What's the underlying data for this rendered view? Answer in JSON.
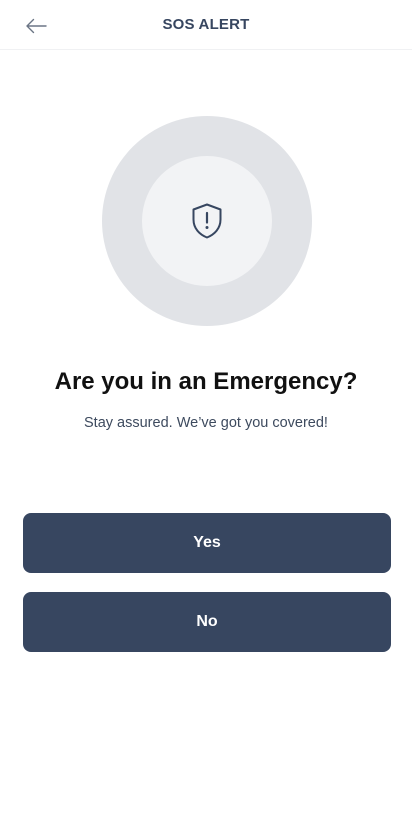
{
  "header": {
    "title": "SOS ALERT",
    "back_icon": "arrow-left-icon"
  },
  "emblem": {
    "icon": "shield-alert-icon",
    "outer_color": "#e1e3e7",
    "inner_color": "#f2f3f5",
    "icon_color": "#374660"
  },
  "main": {
    "headline": "Are you in an Emergency?",
    "subtext": "Stay assured. We’ve got you covered!"
  },
  "buttons": {
    "yes_label": "Yes",
    "no_label": "No",
    "color": "#374660"
  }
}
